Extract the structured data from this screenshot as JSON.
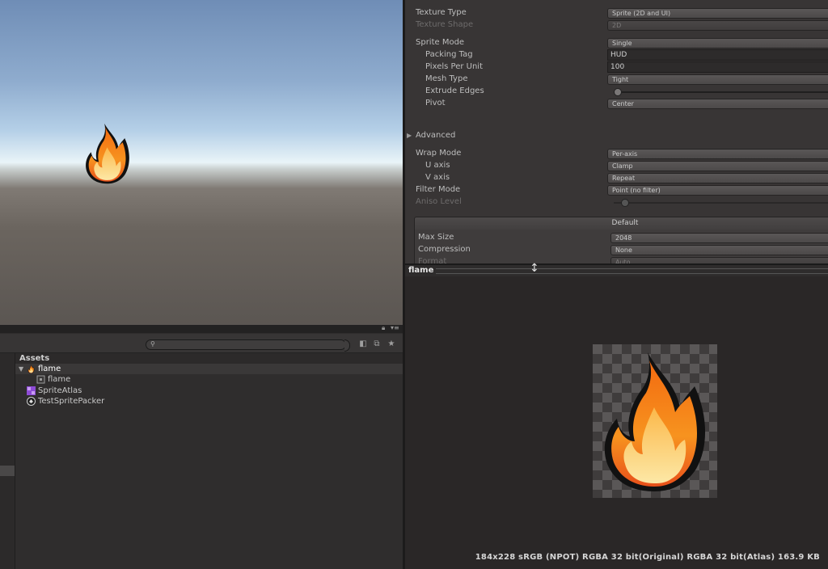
{
  "scene": {},
  "project": {
    "search_placeholder": "",
    "assets_header": "Assets",
    "tree": [
      {
        "label": "flame",
        "icon": "flame-icon",
        "selected": true
      },
      {
        "label": "flame",
        "icon": "sprite-icon"
      },
      {
        "label": "SpriteAtlas",
        "icon": "sprite-atlas-icon"
      },
      {
        "label": "TestSpritePacker",
        "icon": "unity-icon"
      }
    ]
  },
  "inspector": {
    "texture_type_label": "Texture Type",
    "texture_type_value": "Sprite (2D and UI)",
    "texture_shape_label": "Texture Shape",
    "texture_shape_value": "2D",
    "sprite_mode_label": "Sprite Mode",
    "sprite_mode_value": "Single",
    "packing_tag_label": "Packing Tag",
    "packing_tag_value": "HUD",
    "pixels_per_unit_label": "Pixels Per Unit",
    "pixels_per_unit_value": "100",
    "mesh_type_label": "Mesh Type",
    "mesh_type_value": "Tight",
    "extrude_edges_label": "Extrude Edges",
    "pivot_label": "Pivot",
    "pivot_value": "Center",
    "advanced_label": "Advanced",
    "wrap_mode_label": "Wrap Mode",
    "wrap_mode_value": "Per-axis",
    "u_axis_label": "U axis",
    "u_axis_value": "Clamp",
    "v_axis_label": "V axis",
    "v_axis_value": "Repeat",
    "filter_mode_label": "Filter Mode",
    "filter_mode_value": "Point (no filter)",
    "aniso_level_label": "Aniso Level",
    "platform_tab": "Default",
    "max_size_label": "Max Size",
    "max_size_value": "2048",
    "compression_label": "Compression",
    "compression_value": "None",
    "format_label": "Format",
    "format_value": "Auto"
  },
  "preview": {
    "title": "flame",
    "info": "184x228 sRGB (NPOT)   RGBA 32 bit(Original) RGBA 32 bit(Atlas)   163.9 KB"
  },
  "colors": {
    "flame_outer": "#f08a1a",
    "flame_inner": "#fcd66a",
    "outline": "#111111"
  }
}
